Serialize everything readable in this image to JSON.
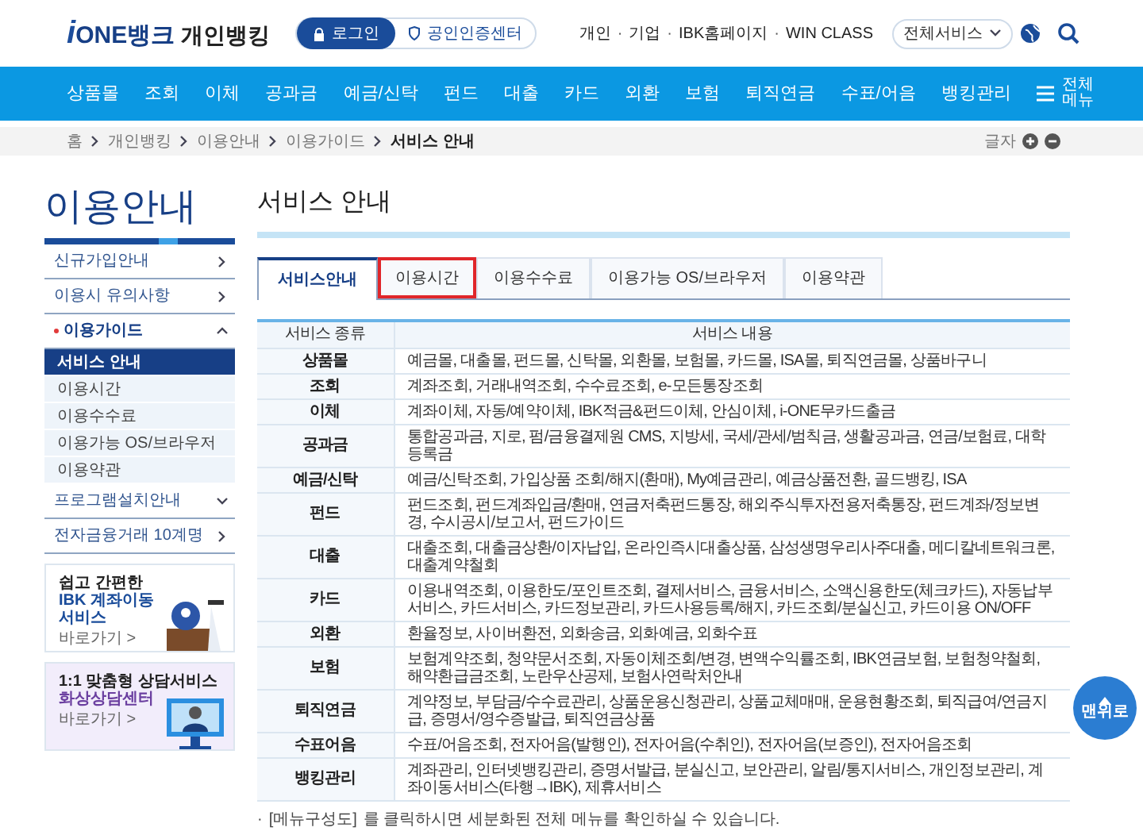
{
  "header": {
    "logo": {
      "mark": "i",
      "name": "ONE뱅크",
      "service": "개인뱅킹"
    },
    "login_button": "로그인",
    "cert_button": "공인인증센터",
    "separator": "·",
    "links": [
      "개인",
      "기업",
      "IBK홈페이지",
      "WIN CLASS"
    ],
    "service_select": "전체서비스"
  },
  "nav": {
    "items": [
      "상품몰",
      "조회",
      "이체",
      "공과금",
      "예금/신탁",
      "펀드",
      "대출",
      "카드",
      "외환",
      "보험",
      "퇴직연금",
      "수표/어음",
      "뱅킹관리"
    ],
    "menu_label": "전체 메뉴"
  },
  "breadcrumb": [
    "홈",
    "개인뱅킹",
    "이용안내",
    "이용가이드",
    "서비스 안내"
  ],
  "font_size_label": "글자",
  "sidebar": {
    "title": "이용안내",
    "items": [
      {
        "label": "신규가입안내",
        "kind": "link",
        "selected": false
      },
      {
        "label": "이용시 유의사항",
        "kind": "link",
        "selected": false
      },
      {
        "label": "이용가이드",
        "kind": "group",
        "selected": true,
        "expanded": true,
        "children": [
          {
            "label": "서비스 안내",
            "selected": true
          },
          {
            "label": "이용시간",
            "selected": false
          },
          {
            "label": "이용수수료",
            "selected": false
          },
          {
            "label": "이용가능 OS/브라우저",
            "selected": false
          },
          {
            "label": "이용약관",
            "selected": false
          }
        ]
      },
      {
        "label": "프로그램설치안내",
        "kind": "group",
        "selected": false,
        "expanded": false
      },
      {
        "label": "전자금융거래 10계명",
        "kind": "link",
        "selected": false
      }
    ]
  },
  "banners": [
    {
      "kind": "transfer",
      "eyebrow": "쉽고 간편한",
      "title": "IBK 계좌이동 서비스",
      "link": "바로가기 >"
    },
    {
      "kind": "video",
      "eyebrow": "1:1 맞춤형 상담서비스",
      "title": "화상상담센터",
      "link": "바로가기 >"
    }
  ],
  "page_title": "서비스 안내",
  "tabs": [
    {
      "label": "서비스안내",
      "selected": true,
      "highlighted": false
    },
    {
      "label": "이용시간",
      "selected": false,
      "highlighted": true
    },
    {
      "label": "이용수수료",
      "selected": false,
      "highlighted": false
    },
    {
      "label": "이용가능 OS/브라우저",
      "selected": false,
      "highlighted": false
    },
    {
      "label": "이용약관",
      "selected": false,
      "highlighted": false
    }
  ],
  "table": {
    "columns": [
      "서비스 종류",
      "서비스 내용"
    ],
    "rows": [
      [
        "상품몰",
        "예금몰, 대출몰, 펀드몰, 신탁몰, 외환몰, 보험몰, 카드몰, ISA몰, 퇴직연금몰, 상품바구니"
      ],
      [
        "조회",
        "계좌조회, 거래내역조회, 수수료조회, e-모든통장조회"
      ],
      [
        "이체",
        "계좌이체, 자동/예약이체, IBK적금&펀드이체, 안심이체, i-ONE무카드출금"
      ],
      [
        "공과금",
        "통합공과금, 지로, 펌/금융결제원 CMS, 지방세, 국세/관세/범칙금, 생활공과금, 연금/보험료, 대학등록금"
      ],
      [
        "예금/신탁",
        "예금/신탁조회, 가입상품 조회/해지(환매), My예금관리, 예금상품전환, 골드뱅킹, ISA"
      ],
      [
        "펀드",
        "펀드조회, 펀드계좌입금/환매, 연금저축펀드통장, 해외주식투자전용저축통장, 펀드계좌/정보변경, 수시공시/보고서, 펀드가이드"
      ],
      [
        "대출",
        "대출조회, 대출금상환/이자납입, 온라인즉시대출상품, 삼성생명우리사주대출, 메디칼네트워크론, 대출계약철회"
      ],
      [
        "카드",
        "이용내역조회, 이용한도/포인트조회, 결제서비스, 금융서비스, 소액신용한도(체크카드), 자동납부 서비스, 카드서비스, 카드정보관리, 카드사용등록/해지, 카드조회/분실신고, 카드이용 ON/OFF"
      ],
      [
        "외환",
        "환율정보, 사이버환전, 외화송금, 외화예금, 외화수표"
      ],
      [
        "보험",
        "보험계약조회, 청약문서조회, 자동이체조회/변경, 변액수익률조회, IBK연금보험, 보험청약철회, 해약환급금조회, 노란우산공제, 보험사연락처안내"
      ],
      [
        "퇴직연금",
        "계약정보, 부담금/수수료관리, 상품운용신청관리, 상품교체매매, 운용현황조회, 퇴직급여/연금지급, 증명서/영수증발급, 퇴직연금상품"
      ],
      [
        "수표어음",
        "수표/어음조회, 전자어음(발행인), 전자어음(수취인), 전자어음(보증인), 전자어음조회"
      ],
      [
        "뱅킹관리",
        "계좌관리, 인터넷뱅킹관리, 증명서발급, 분실신고, 보안관리, 알림/통지서비스, 개인정보관리, 계좌이동서비스(타행→IBK), 제휴서비스"
      ]
    ]
  },
  "footnote": {
    "bullet": "·",
    "link": "[메뉴구성도]",
    "text": "를 클릭하시면 세분화된 전체 메뉴를 확인하실 수 있습니다."
  },
  "top_button": "맨위로"
}
